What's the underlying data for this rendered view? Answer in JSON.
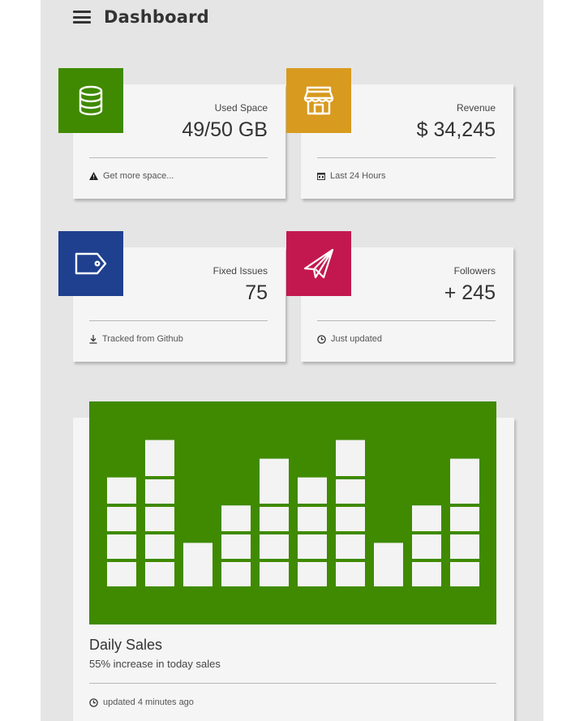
{
  "header": {
    "title": "Dashboard",
    "menu_icon": "hamburger-icon"
  },
  "cards": [
    {
      "icon": "database-icon",
      "color": "#3f8a00",
      "category": "Used Space",
      "value": "49/50 GB",
      "footer_icon": "warning-icon",
      "footer": "Get more space..."
    },
    {
      "icon": "store-icon",
      "color": "#d89a1f",
      "category": "Revenue",
      "value": "$ 34,245",
      "footer_icon": "calendar-icon",
      "footer": "Last 24 Hours"
    },
    {
      "icon": "tag-icon",
      "color": "#1e408f",
      "category": "Fixed Issues",
      "value": "75",
      "footer_icon": "download-icon",
      "footer": "Tracked from Github"
    },
    {
      "icon": "paper-plane-icon",
      "color": "#c2184f",
      "category": "Followers",
      "value": "+ 245",
      "footer_icon": "clock-icon",
      "footer": "Just updated"
    }
  ],
  "sales": {
    "title": "Daily Sales",
    "subtitle": "55% increase in today sales",
    "footer_icon": "clock-icon",
    "footer": "updated 4 minutes ago",
    "chart_color": "#3f8a00",
    "chart_data": {
      "type": "bar",
      "style": "segmented-blocks",
      "values": [
        6,
        8,
        2.5,
        4.5,
        7,
        6,
        8,
        2.5,
        4.5,
        7
      ],
      "ylim": [
        0,
        8.5
      ],
      "grid": false
    }
  }
}
